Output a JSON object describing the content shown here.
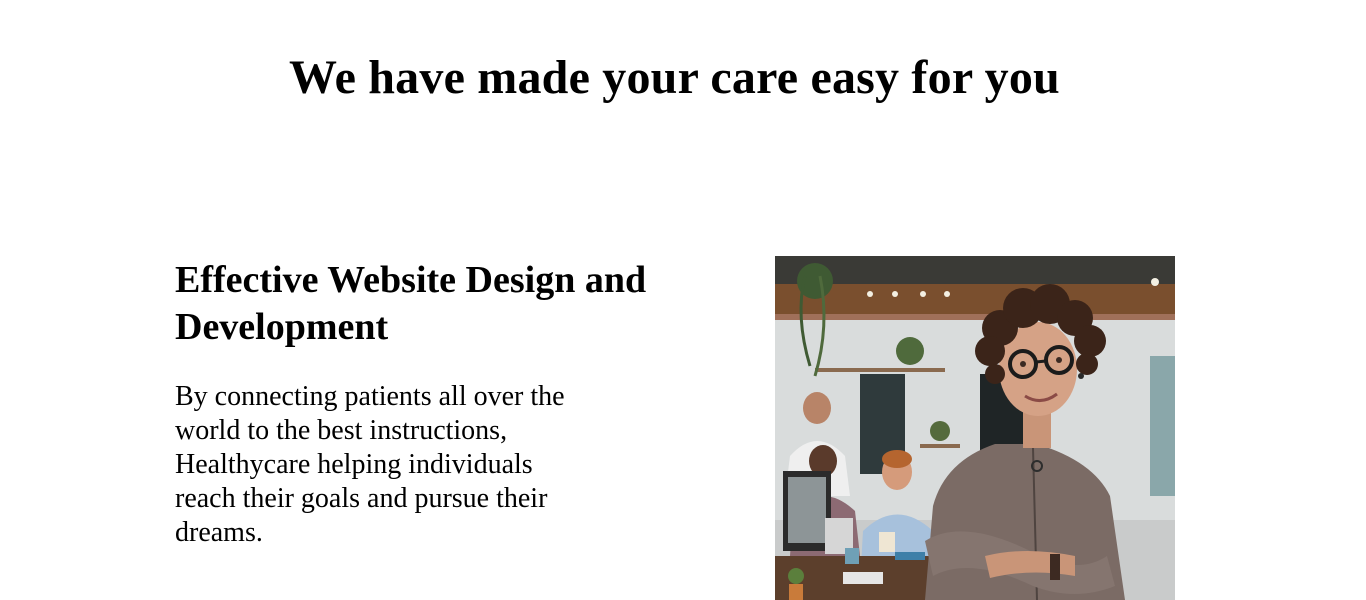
{
  "section": {
    "title": "We have made your care easy for you"
  },
  "feature": {
    "heading": "Effective Website Design and Development",
    "text": "By connecting patients all over the world to the best instructions, Healthycare helping individuals reach their goals and pursue their dreams.",
    "image_icon": "photo-professional-woman-office"
  },
  "scrollbar": {
    "up_glyph": "▲",
    "down_glyph": "▼"
  }
}
